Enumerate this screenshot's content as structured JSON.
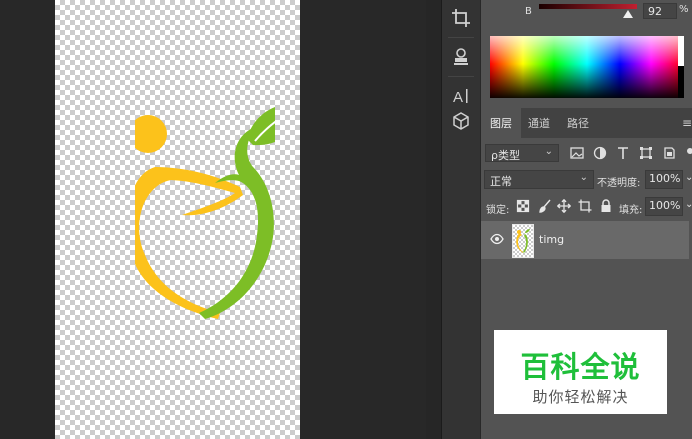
{
  "color_panel": {
    "channel_label": "B",
    "channel_value": "92",
    "channel_unit": "%"
  },
  "layers_panel": {
    "tabs": [
      {
        "label": "图层",
        "active": true
      },
      {
        "label": "通道",
        "active": false
      },
      {
        "label": "路径",
        "active": false
      }
    ],
    "filter_dropdown": "ρ类型",
    "blend_mode": "正常",
    "opacity_label": "不透明度:",
    "opacity_value": "100%",
    "lock_label": "锁定:",
    "fill_label": "填充:",
    "fill_value": "100%",
    "layers": [
      {
        "name": "timg",
        "visible": true
      }
    ]
  },
  "watermark": {
    "title": "百科全说",
    "subtitle": "助你轻松解决"
  },
  "colors": {
    "logo_yellow": "#fcc21b",
    "logo_green": "#7dbe26",
    "watermark_green": "#1fbf3a",
    "panel_bg": "#535353",
    "canvas_bg": "#282828"
  },
  "icons": [
    "crop-icon",
    "stamp-icon",
    "type-icon",
    "3d-icon",
    "eye-icon",
    "image-filter-icon",
    "adjustment-filter-icon",
    "text-filter-icon",
    "shape-filter-icon",
    "smart-object-filter-icon",
    "lock-transparent-icon",
    "lock-paint-icon",
    "lock-move-icon",
    "lock-artboard-icon",
    "lock-all-icon"
  ]
}
